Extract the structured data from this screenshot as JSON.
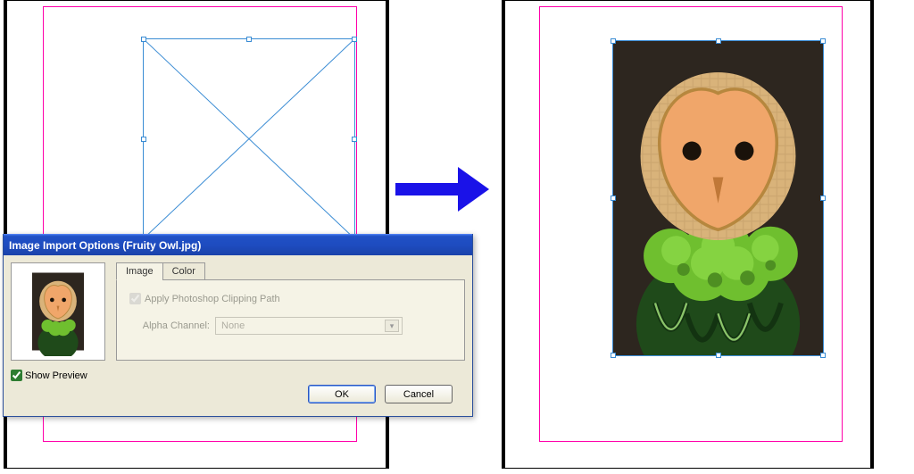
{
  "dialog": {
    "title": "Image Import Options (Fruity Owl.jpg)",
    "tabs": {
      "image": "Image",
      "color": "Color"
    },
    "applyClippingPath": "Apply Photoshop Clipping Path",
    "alphaLabel": "Alpha Channel:",
    "alphaValue": "None",
    "showPreview": "Show Preview",
    "ok": "OK",
    "cancel": "Cancel"
  }
}
